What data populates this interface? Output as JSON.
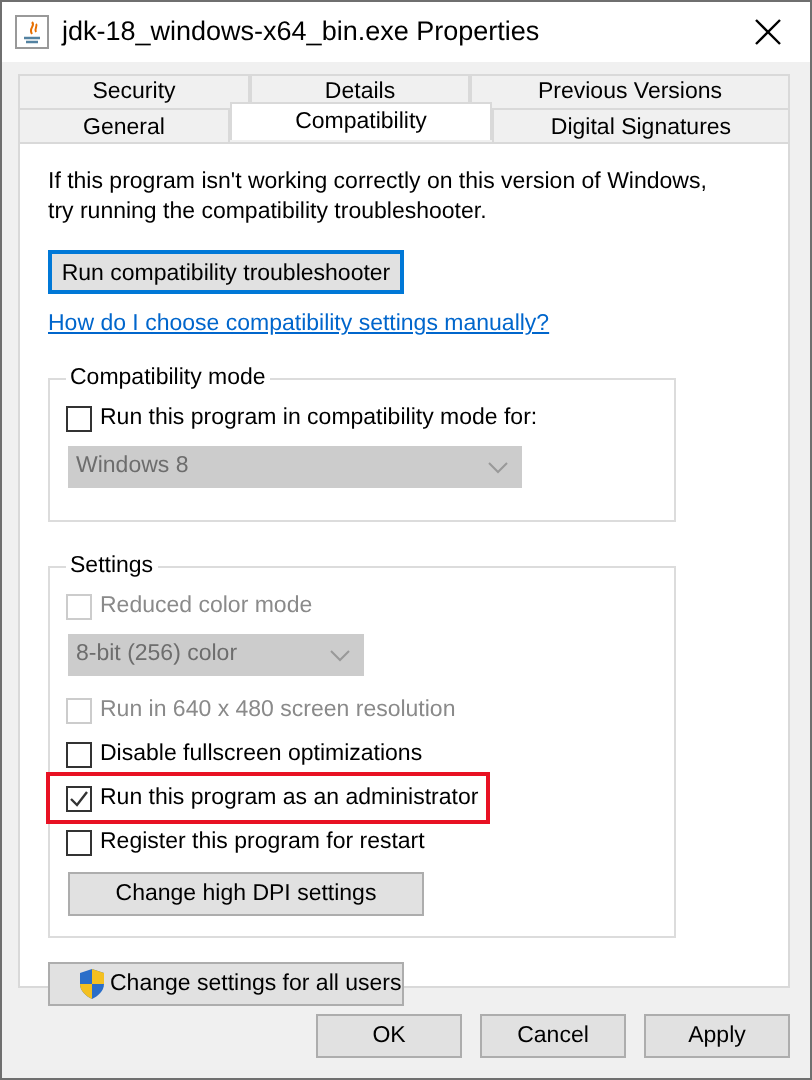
{
  "window": {
    "title": "jdk-18_windows-x64_bin.exe Properties"
  },
  "tab_rows": [
    [
      {
        "label": "Security",
        "selected": false
      },
      {
        "label": "Details",
        "selected": false
      },
      {
        "label": "Previous Versions",
        "selected": false
      }
    ],
    [
      {
        "label": "General",
        "selected": false
      },
      {
        "label": "Compatibility",
        "selected": true
      },
      {
        "label": "Digital Signatures",
        "selected": false
      }
    ]
  ],
  "intro": [
    "If this program isn't working correctly on this version of Windows,",
    "try running the compatibility troubleshooter."
  ],
  "troubleshooter_button": {
    "label": "Run compatibility troubleshooter",
    "focused": true
  },
  "help_link": "How do I choose compatibility settings manually?",
  "groups": [
    {
      "title": "Compatibility mode",
      "items": [
        {
          "kind": "checkbox",
          "label": "Run this program in compatibility mode for:",
          "checked": false,
          "disabled": false,
          "highlighted": false
        },
        {
          "kind": "select",
          "value": "Windows 8",
          "disabled": true
        }
      ]
    },
    {
      "title": "Settings",
      "items": [
        {
          "kind": "checkbox",
          "label": "Reduced color mode",
          "checked": false,
          "disabled": true,
          "highlighted": false
        },
        {
          "kind": "select",
          "value": "8-bit (256) color",
          "disabled": true
        },
        {
          "kind": "checkbox",
          "label": "Run in 640 x 480 screen resolution",
          "checked": false,
          "disabled": true,
          "highlighted": false
        },
        {
          "kind": "checkbox",
          "label": "Disable fullscreen optimizations",
          "checked": false,
          "disabled": false,
          "highlighted": false
        },
        {
          "kind": "checkbox",
          "label": "Run this program as an administrator",
          "checked": true,
          "disabled": false,
          "highlighted": true
        },
        {
          "kind": "checkbox",
          "label": "Register this program for restart",
          "checked": false,
          "disabled": false,
          "highlighted": false
        },
        {
          "kind": "button",
          "label": "Change high DPI settings"
        }
      ]
    }
  ],
  "all_users_button": "Change settings for all users",
  "dialog_buttons": [
    "OK",
    "Cancel",
    "Apply"
  ]
}
